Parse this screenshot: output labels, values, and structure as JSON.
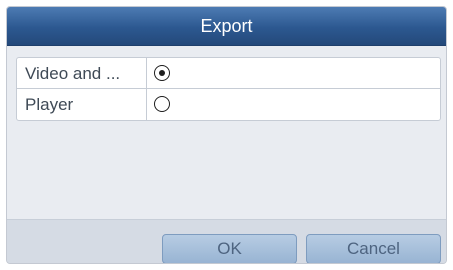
{
  "dialog": {
    "title": "Export",
    "options": [
      {
        "label": "Video and ...",
        "selected": true
      },
      {
        "label": "Player",
        "selected": false
      }
    ],
    "buttons": {
      "ok_label": "OK",
      "cancel_label": "Cancel"
    }
  },
  "colors": {
    "titlebar": "#2c5890",
    "button": "#a8c0dc",
    "panel": "#e9ecf1"
  }
}
